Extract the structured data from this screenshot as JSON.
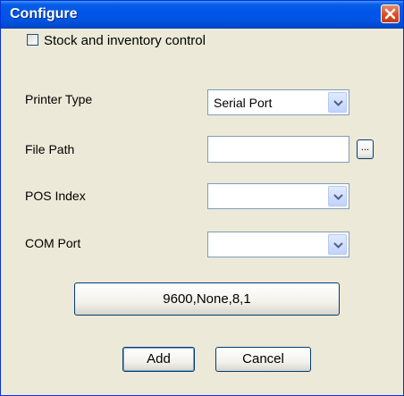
{
  "window": {
    "title": "Configure",
    "close_label": "Close"
  },
  "stock_control": {
    "label": "Stock and inventory control",
    "checked": false
  },
  "printer_type": {
    "label": "Printer Type",
    "value": "Serial Port"
  },
  "file_path": {
    "label": "File Path",
    "value": "",
    "browse_label": "..."
  },
  "pos_index": {
    "label": "POS Index",
    "value": ""
  },
  "com_port": {
    "label": "COM Port",
    "value": ""
  },
  "serial_settings": {
    "label": "9600,None,8,1"
  },
  "buttons": {
    "add": "Add",
    "cancel": "Cancel"
  },
  "colors": {
    "titlebar": "#0054E3",
    "dialog_bg": "#ECE9D8",
    "close_button": "#D74A22"
  }
}
